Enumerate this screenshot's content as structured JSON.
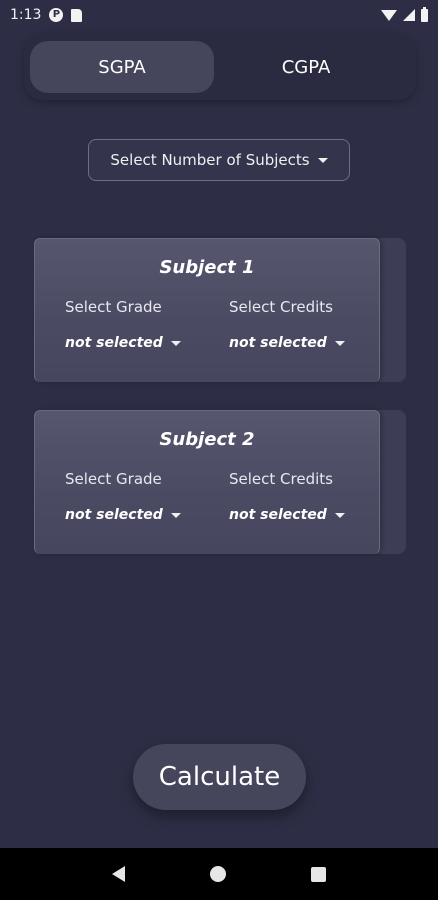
{
  "status_bar": {
    "time": "1:13",
    "icons": [
      "p-icon",
      "sd-card-icon",
      "wifi-icon",
      "signal-icon",
      "battery-icon"
    ]
  },
  "tabs": [
    {
      "label": "SGPA",
      "active": true
    },
    {
      "label": "CGPA",
      "active": false
    }
  ],
  "subjects_dropdown": {
    "label": "Select Number of Subjects"
  },
  "subjects": [
    {
      "title": "Subject 1",
      "grade_label": "Select Grade",
      "grade_value": "not selected",
      "credits_label": "Select Credits",
      "credits_value": "not selected"
    },
    {
      "title": "Subject 2",
      "grade_label": "Select Grade",
      "grade_value": "not selected",
      "credits_label": "Select Credits",
      "credits_value": "not selected"
    }
  ],
  "calculate_button": {
    "label": "Calculate"
  },
  "colors": {
    "background": "#2d2d45",
    "tab_active": "#45455c",
    "card": "#4a4a63",
    "button": "#45455c"
  }
}
